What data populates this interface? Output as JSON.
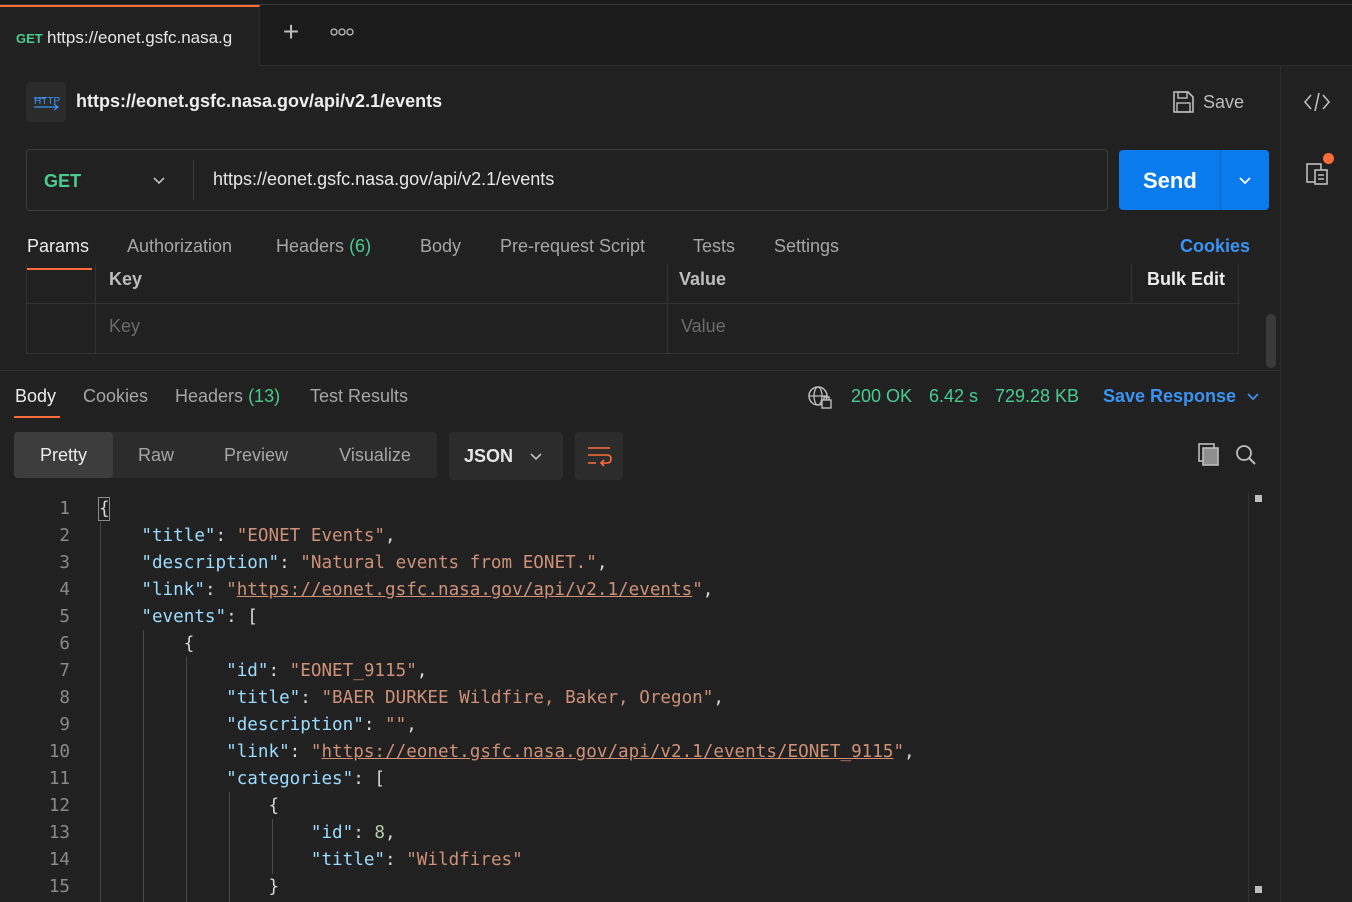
{
  "tab": {
    "method": "GET",
    "url": "https://eonet.gsfc.nasa.g"
  },
  "tabbar": {
    "new_tab": "+",
    "more": "ooo"
  },
  "request": {
    "badge": "HTTP",
    "title": "https://eonet.gsfc.nasa.gov/api/v2.1/events",
    "save_label": "Save",
    "method": "GET",
    "url": "https://eonet.gsfc.nasa.gov/api/v2.1/events",
    "send_label": "Send"
  },
  "request_tabs": {
    "params": "Params",
    "authorization": "Authorization",
    "headers": "Headers",
    "headers_count": "(6)",
    "body": "Body",
    "prerequest": "Pre-request Script",
    "tests": "Tests",
    "settings": "Settings",
    "cookies": "Cookies"
  },
  "params_table": {
    "key_header": "Key",
    "value_header": "Value",
    "bulk_edit": "Bulk Edit",
    "key_placeholder": "Key",
    "value_placeholder": "Value"
  },
  "response_tabs": {
    "body": "Body",
    "cookies": "Cookies",
    "headers": "Headers",
    "headers_count": "(13)",
    "test_results": "Test Results"
  },
  "response_meta": {
    "status": "200 OK",
    "time": "6.42 s",
    "size": "729.28 KB",
    "save_response": "Save Response"
  },
  "view_modes": {
    "pretty": "Pretty",
    "raw": "Raw",
    "preview": "Preview",
    "visualize": "Visualize"
  },
  "format": "JSON",
  "code_lines": [
    {
      "n": "1",
      "text": "{"
    },
    {
      "n": "2",
      "text": "    \"title\": \"EONET Events\","
    },
    {
      "n": "3",
      "text": "    \"description\": \"Natural events from EONET.\","
    },
    {
      "n": "4",
      "text": "    \"link\": \"https://eonet.gsfc.nasa.gov/api/v2.1/events\","
    },
    {
      "n": "5",
      "text": "    \"events\": ["
    },
    {
      "n": "6",
      "text": "        {"
    },
    {
      "n": "7",
      "text": "            \"id\": \"EONET_9115\","
    },
    {
      "n": "8",
      "text": "            \"title\": \"BAER DURKEE Wildfire, Baker, Oregon\","
    },
    {
      "n": "9",
      "text": "            \"description\": \"\","
    },
    {
      "n": "10",
      "text": "            \"link\": \"https://eonet.gsfc.nasa.gov/api/v2.1/events/EONET_9115\","
    },
    {
      "n": "11",
      "text": "            \"categories\": ["
    },
    {
      "n": "12",
      "text": "                {"
    },
    {
      "n": "13",
      "text": "                    \"id\": 8,"
    },
    {
      "n": "14",
      "text": "                    \"title\": \"Wildfires\""
    },
    {
      "n": "15",
      "text": "                }"
    }
  ]
}
